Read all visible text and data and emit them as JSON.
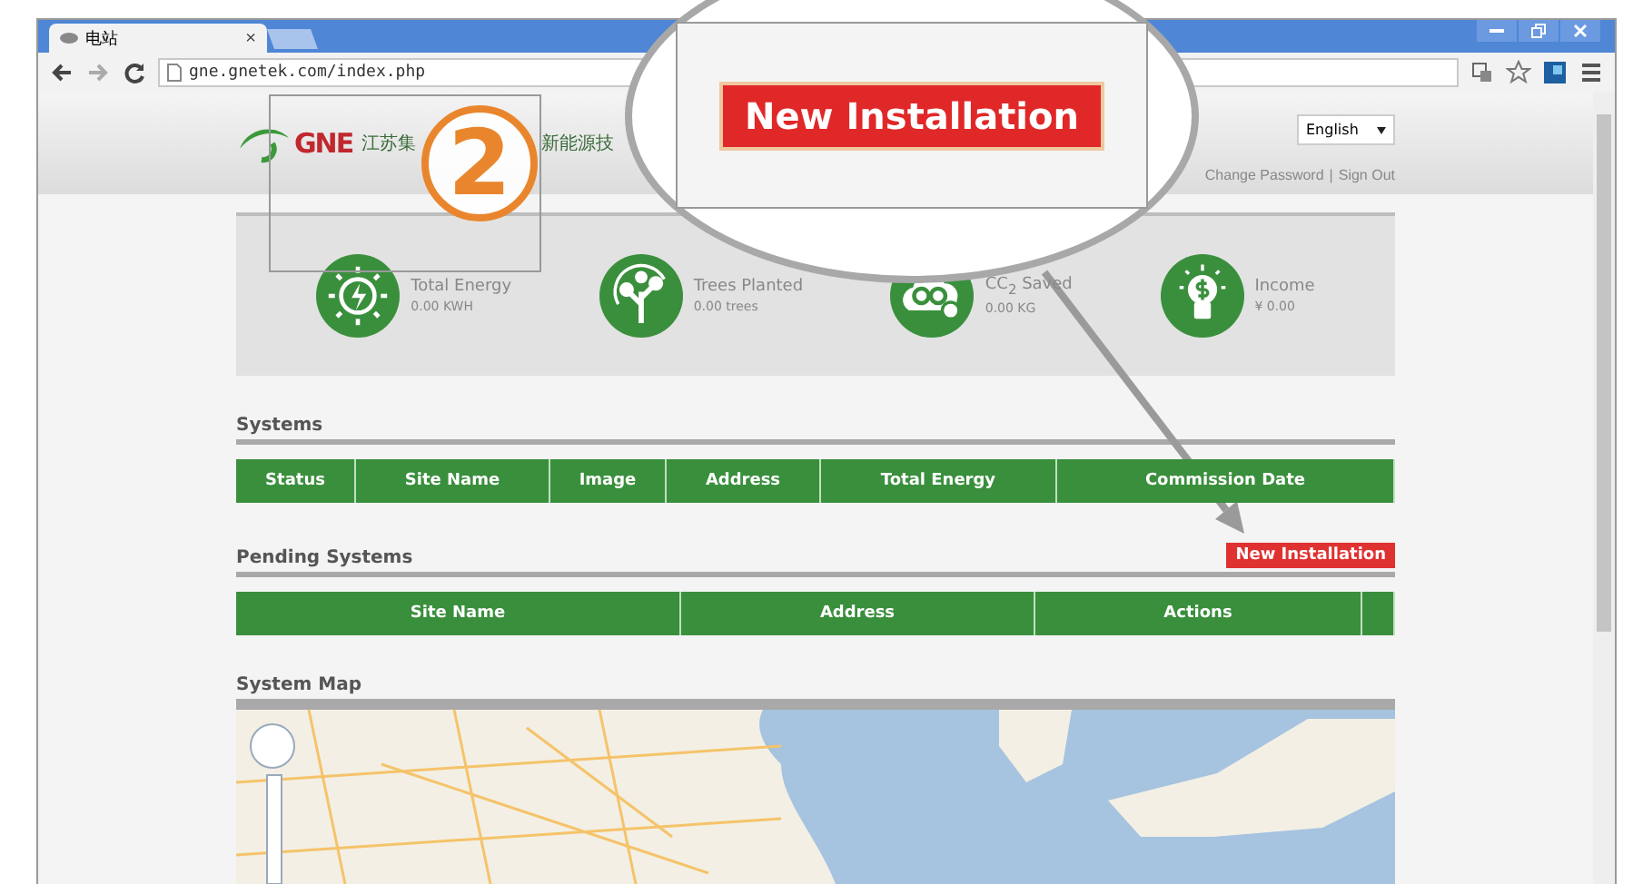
{
  "browser": {
    "tab_title": "电站",
    "tab_close": "×",
    "address": "gne.gnetek.com/index.php"
  },
  "header": {
    "logo": "GNE",
    "company_name_left": "江苏集",
    "company_name_right": "新能源技",
    "language": "English",
    "links": [
      {
        "label": "Change Password"
      },
      {
        "label": "Sign Out"
      }
    ],
    "link_separator": "|"
  },
  "stats": [
    {
      "kind": "energy",
      "label": "Total Energy",
      "value": "0.00 KWH"
    },
    {
      "kind": "trees",
      "label": "Trees Planted",
      "value": "0.00 trees"
    },
    {
      "kind": "co2",
      "label": "CC$_{2}$ Saved",
      "value": "0.00 KG"
    },
    {
      "kind": "income",
      "label": "Income",
      "value": "¥ 0.00"
    }
  ],
  "systems": {
    "title": "Systems",
    "columns": [
      "Status",
      "Site Name",
      "Image",
      "Address",
      "Total Energy",
      "Commission Date"
    ]
  },
  "pending_systems": {
    "title": "Pending Systems",
    "button": "New Installation",
    "columns": [
      "Site Name",
      "Address",
      "Actions",
      ""
    ]
  },
  "system_map": {
    "title": "System Map"
  },
  "annotation": {
    "step": "2",
    "callout_button": "New Installation"
  }
}
